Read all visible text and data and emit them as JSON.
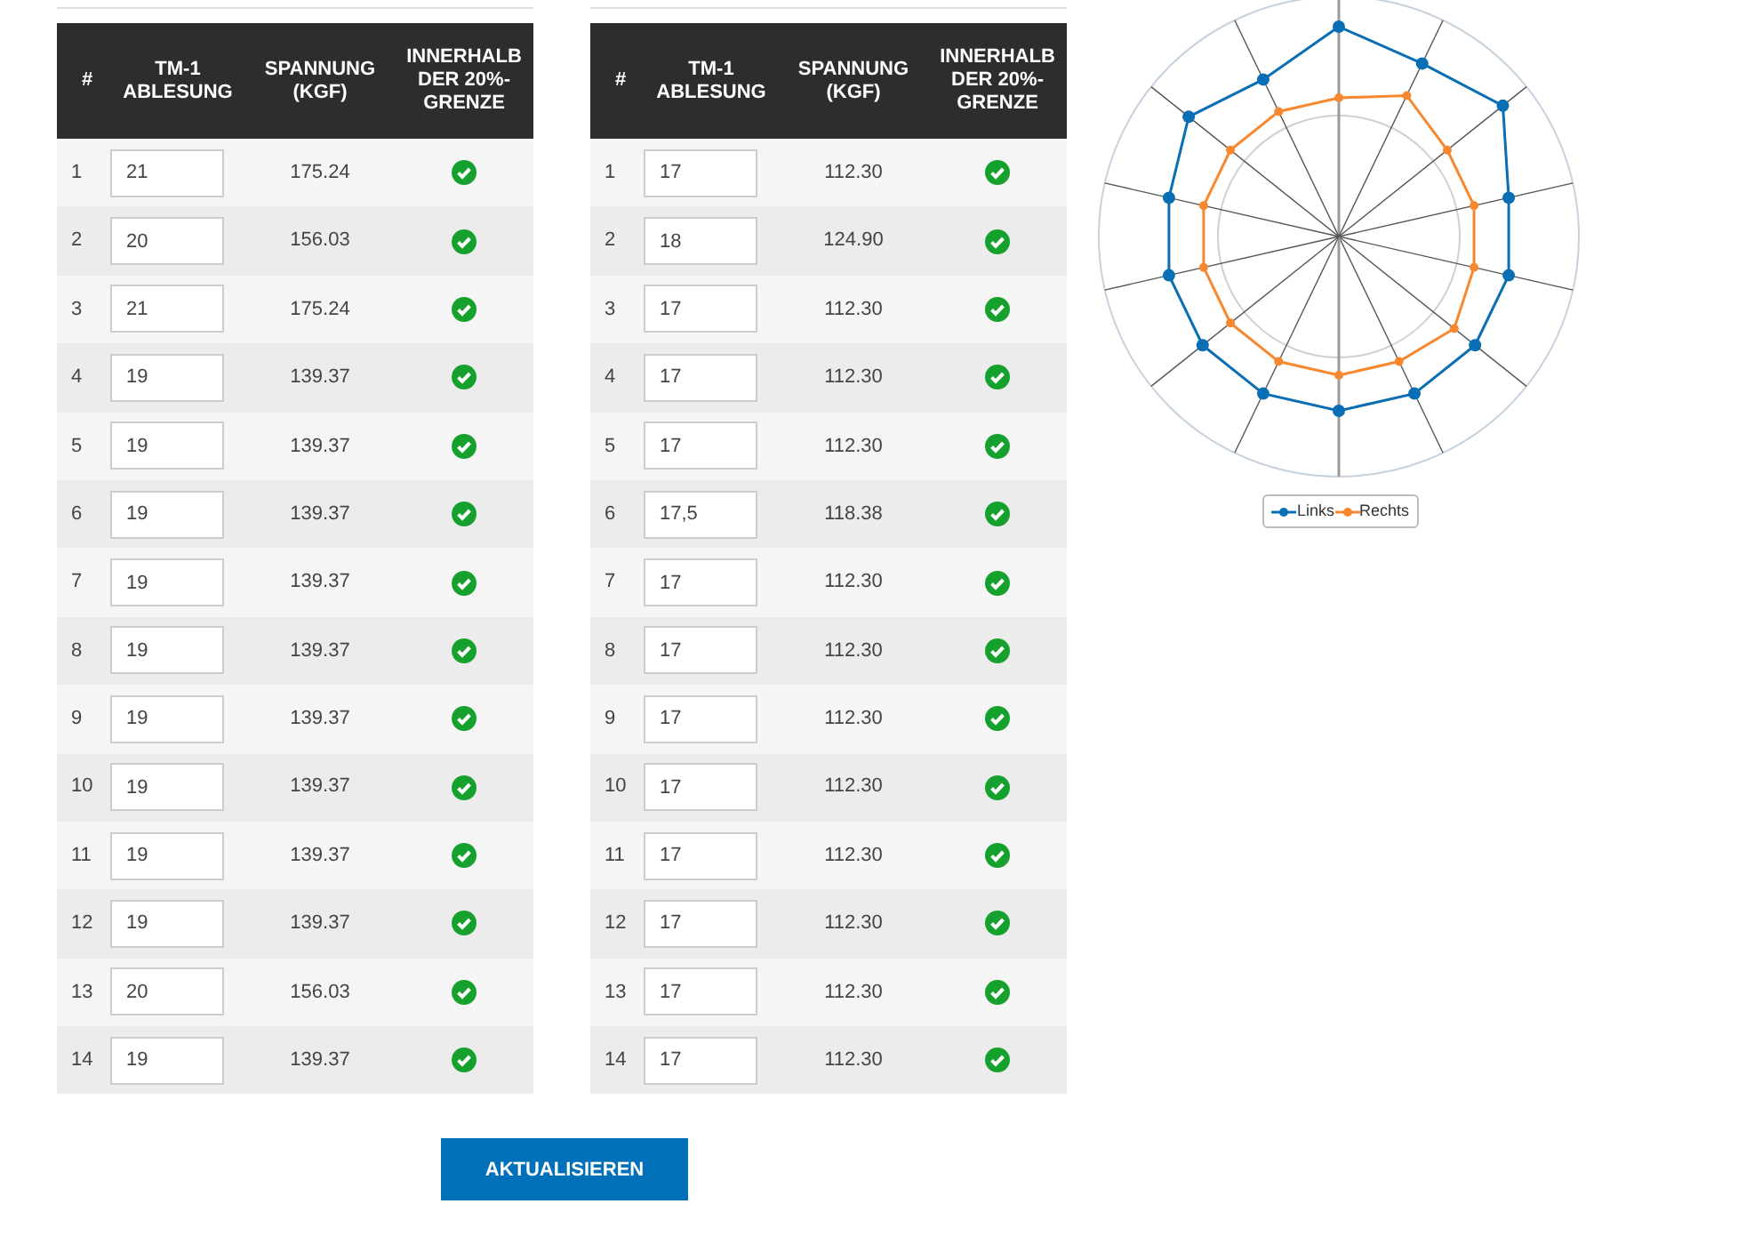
{
  "tables": [
    {
      "columns": [
        "#",
        "TM-1 ABLESUNG",
        "SPANNUNG (KGF)",
        "INNERHALB DER 20%-GRENZE"
      ],
      "rows": [
        {
          "index": "1",
          "reading": "21",
          "tension": "175.24",
          "within": true
        },
        {
          "index": "2",
          "reading": "20",
          "tension": "156.03",
          "within": true
        },
        {
          "index": "3",
          "reading": "21",
          "tension": "175.24",
          "within": true
        },
        {
          "index": "4",
          "reading": "19",
          "tension": "139.37",
          "within": true
        },
        {
          "index": "5",
          "reading": "19",
          "tension": "139.37",
          "within": true
        },
        {
          "index": "6",
          "reading": "19",
          "tension": "139.37",
          "within": true
        },
        {
          "index": "7",
          "reading": "19",
          "tension": "139.37",
          "within": true
        },
        {
          "index": "8",
          "reading": "19",
          "tension": "139.37",
          "within": true
        },
        {
          "index": "9",
          "reading": "19",
          "tension": "139.37",
          "within": true
        },
        {
          "index": "10",
          "reading": "19",
          "tension": "139.37",
          "within": true
        },
        {
          "index": "11",
          "reading": "19",
          "tension": "139.37",
          "within": true
        },
        {
          "index": "12",
          "reading": "19",
          "tension": "139.37",
          "within": true
        },
        {
          "index": "13",
          "reading": "20",
          "tension": "156.03",
          "within": true
        },
        {
          "index": "14",
          "reading": "19",
          "tension": "139.37",
          "within": true
        }
      ]
    },
    {
      "columns": [
        "#",
        "TM-1 ABLESUNG",
        "SPANNUNG (KGF)",
        "INNERHALB DER 20%-GRENZE"
      ],
      "rows": [
        {
          "index": "1",
          "reading": "17",
          "tension": "112.30",
          "within": true
        },
        {
          "index": "2",
          "reading": "18",
          "tension": "124.90",
          "within": true
        },
        {
          "index": "3",
          "reading": "17",
          "tension": "112.30",
          "within": true
        },
        {
          "index": "4",
          "reading": "17",
          "tension": "112.30",
          "within": true
        },
        {
          "index": "5",
          "reading": "17",
          "tension": "112.30",
          "within": true
        },
        {
          "index": "6",
          "reading": "17,5",
          "tension": "118.38",
          "within": true
        },
        {
          "index": "7",
          "reading": "17",
          "tension": "112.30",
          "within": true
        },
        {
          "index": "8",
          "reading": "17",
          "tension": "112.30",
          "within": true
        },
        {
          "index": "9",
          "reading": "17",
          "tension": "112.30",
          "within": true
        },
        {
          "index": "10",
          "reading": "17",
          "tension": "112.30",
          "within": true
        },
        {
          "index": "11",
          "reading": "17",
          "tension": "112.30",
          "within": true
        },
        {
          "index": "12",
          "reading": "17",
          "tension": "112.30",
          "within": true
        },
        {
          "index": "13",
          "reading": "17",
          "tension": "112.30",
          "within": true
        },
        {
          "index": "14",
          "reading": "17",
          "tension": "112.30",
          "within": true
        }
      ]
    }
  ],
  "radar": {
    "legend": [
      {
        "name": "Links",
        "color": "#0a6eb4"
      },
      {
        "name": "Rechts",
        "color": "#f7882f"
      }
    ]
  },
  "update_button": "AKTUALISIEREN"
}
